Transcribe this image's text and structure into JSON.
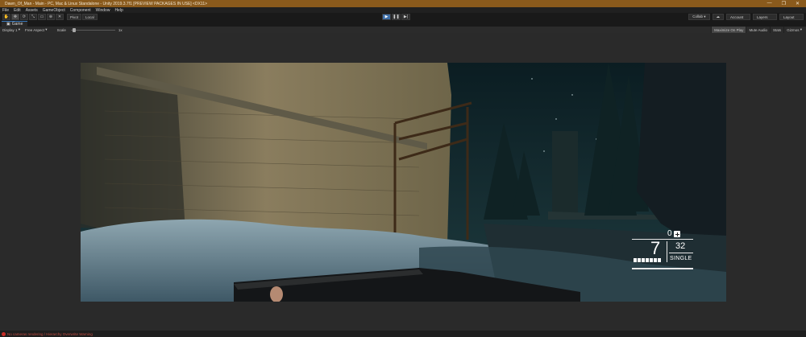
{
  "window": {
    "title": "Dawn_Of_Man - Main - PC, Mac & Linux Standalone - Unity 2019.3.7f1 [PREVIEW PACKAGES IN USE] <DX11>",
    "controls": [
      "—",
      "❐",
      "✕"
    ]
  },
  "menu": [
    "File",
    "Edit",
    "Assets",
    "GameObject",
    "Component",
    "Window",
    "Help"
  ],
  "toolbar": {
    "tools": [
      "✋",
      "✥",
      "⟳",
      "⤡",
      "▭",
      "⊕",
      "✕"
    ],
    "pivot_label": "Pivot",
    "local_label": "Local",
    "play_buttons": [
      "▶",
      "❚❚",
      "▶|"
    ],
    "collab_label": "Collab ▾",
    "cloud_icon": "☁",
    "account_label": "Account",
    "layers_label": "Layers",
    "layout_label": "Layout"
  },
  "tab": {
    "label": "Game"
  },
  "game_toolbar": {
    "display": "Display 1",
    "aspect": "Free Aspect",
    "scale_label": "Scale",
    "scale_value": "1x",
    "maximize_label": "Maximize On Play",
    "mute_label": "Mute Audio",
    "stats_label": "Stats",
    "gizmos_label": "Gizmos"
  },
  "hud": {
    "grenades": "0",
    "magazine": "7",
    "reserve": "32",
    "fire_mode": "SINGLE",
    "rounds_loaded_pips": 7
  },
  "status": {
    "message": "No cameras rendering / Hierarchy Overwrite Warning"
  },
  "colors": {
    "titlebar": "#8a5a1c",
    "play_active": "#3d6ea8",
    "error": "#c62c26"
  }
}
